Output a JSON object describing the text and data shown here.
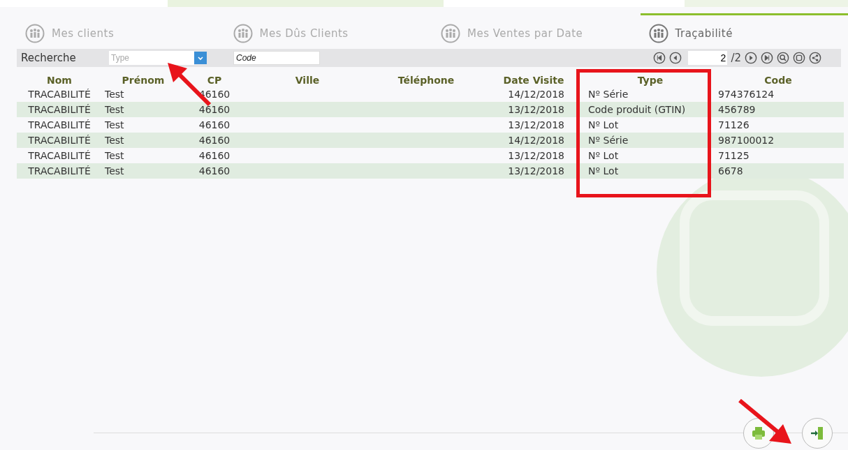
{
  "tabs": [
    {
      "label": "Mes clients",
      "selected": false
    },
    {
      "label": "Mes Dûs Clients",
      "selected": false
    },
    {
      "label": "Mes Ventes par Date",
      "selected": false
    },
    {
      "label": "Traçabilité",
      "selected": true
    }
  ],
  "search": {
    "label": "Recherche",
    "type_field": {
      "placeholder": "Type"
    },
    "code_field": {
      "placeholder": "Code"
    }
  },
  "pager": {
    "page": "2",
    "total": "/2"
  },
  "table": {
    "columns": [
      "Nom",
      "Prénom",
      "CP",
      "Ville",
      "Téléphone",
      "Date Visite",
      "Type",
      "Code"
    ],
    "rows": [
      [
        "TRACABILITÉ",
        "Test",
        "46160",
        "",
        "",
        "14/12/2018",
        "Nº Série",
        "974376124"
      ],
      [
        "TRACABILITÉ",
        "Test",
        "46160",
        "",
        "",
        "13/12/2018",
        "Code produit (GTIN)",
        "456789"
      ],
      [
        "TRACABILITÉ",
        "Test",
        "46160",
        "",
        "",
        "13/12/2018",
        "Nº Lot",
        "71126"
      ],
      [
        "TRACABILITÉ",
        "Test",
        "46160",
        "",
        "",
        "14/12/2018",
        "Nº Série",
        "987100012"
      ],
      [
        "TRACABILITÉ",
        "Test",
        "46160",
        "",
        "",
        "13/12/2018",
        "Nº Lot",
        "71125"
      ],
      [
        "TRACABILITÉ",
        "Test",
        "46160",
        "",
        "",
        "13/12/2018",
        "Nº Lot",
        "6678"
      ]
    ]
  }
}
